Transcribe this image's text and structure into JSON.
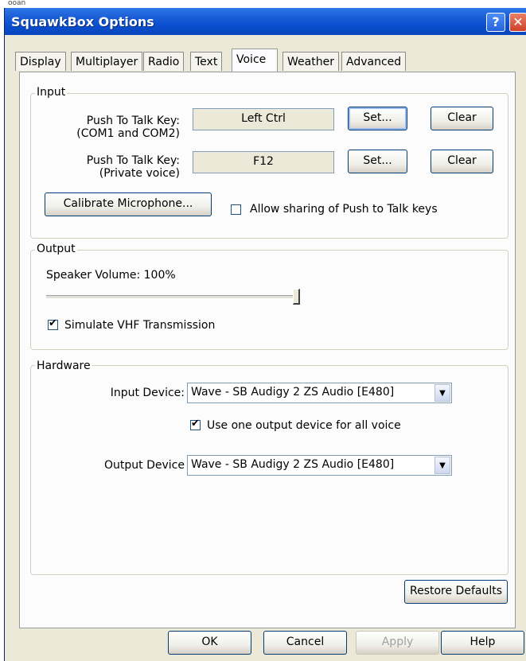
{
  "window": {
    "title": "SquawkBox Options",
    "top_fragment": "ooan"
  },
  "tabs": [
    {
      "label": "Display"
    },
    {
      "label": "Multiplayer"
    },
    {
      "label": "Radio"
    },
    {
      "label": "Text"
    },
    {
      "label": "Voice"
    },
    {
      "label": "Weather"
    },
    {
      "label": "Advanced"
    }
  ],
  "active_tab": "Voice",
  "input": {
    "group_label": "Input",
    "ptt1": {
      "label_line1": "Push To Talk Key:",
      "label_line2": "(COM1 and COM2)",
      "value": "Left Ctrl",
      "set_label": "Set...",
      "clear_label": "Clear"
    },
    "ptt2": {
      "label_line1": "Push To Talk Key:",
      "label_line2": "(Private voice)",
      "value": "F12",
      "set_label": "Set...",
      "clear_label": "Clear"
    },
    "calibrate_label": "Calibrate Microphone...",
    "allow_sharing_label": "Allow sharing of Push to Talk keys",
    "allow_sharing_checked": false
  },
  "output": {
    "group_label": "Output",
    "speaker_volume_label": "Speaker Volume: 100%",
    "speaker_volume_level": 1.0,
    "simulate_vhf_label": "Simulate VHF Transmission",
    "simulate_vhf_checked": true
  },
  "hardware": {
    "group_label": "Hardware",
    "input_device_label": "Input Device:",
    "input_device_value": "Wave - SB Audigy 2 ZS Audio [E480]",
    "one_output_label": "Use one output device for all voice",
    "one_output_checked": true,
    "output_device_label": "Output Device",
    "output_device_value": "Wave - SB Audigy 2 ZS Audio [E480]"
  },
  "restore_defaults_label": "Restore Defaults",
  "footer": {
    "ok": "OK",
    "cancel": "Cancel",
    "apply": "Apply",
    "help": "Help"
  },
  "icons": {
    "help": "help-icon",
    "close": "close-icon",
    "check": "checkmark-icon",
    "dropdown": "chevron-down-icon"
  }
}
